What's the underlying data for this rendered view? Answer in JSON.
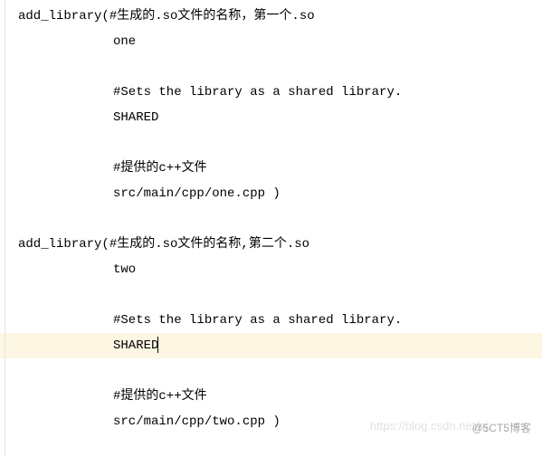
{
  "code": {
    "lines": [
      "add_library(#生成的.so文件的名称，第一个.so",
      "one",
      "",
      "#Sets the library as a shared library.",
      "SHARED",
      "",
      "#提供的c++文件",
      "src/main/cpp/one.cpp )",
      "",
      "add_library(#生成的.so文件的名称,第二个.so",
      "two",
      "",
      "#Sets the library as a shared library.",
      "SHARED",
      "",
      "#提供的c++文件",
      "src/main/cpp/two.cpp )"
    ],
    "indented": [
      false,
      true,
      true,
      true,
      true,
      true,
      true,
      true,
      true,
      false,
      true,
      true,
      true,
      true,
      true,
      true,
      true
    ],
    "highlighted_line_index": 13,
    "cursor_line_index": 13
  },
  "watermarks": {
    "wm1": "https://blog.csdn.net/hj",
    "wm2": "@5CT5博客"
  }
}
